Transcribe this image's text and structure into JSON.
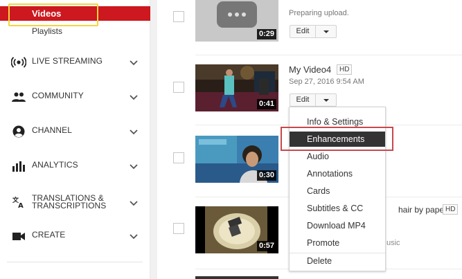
{
  "sidebar": {
    "videos_label": "Videos",
    "playlists_label": "Playlists",
    "sections": [
      {
        "label": "LIVE STREAMING",
        "icon": "live-streaming-icon"
      },
      {
        "label": "COMMUNITY",
        "icon": "community-icon"
      },
      {
        "label": "CHANNEL",
        "icon": "channel-icon"
      },
      {
        "label": "ANALYTICS",
        "icon": "analytics-icon"
      },
      {
        "label": "TRANSLATIONS &",
        "label2": "TRANSCRIPTIONS",
        "icon": "translate-icon"
      },
      {
        "label": "CREATE",
        "icon": "create-icon"
      }
    ],
    "accent_color": "#cc181e"
  },
  "videos": [
    {
      "title": "",
      "status": "Preparing upload.",
      "duration": "0:29",
      "edit_label": "Edit"
    },
    {
      "title": "My Video4",
      "hd": "HD",
      "date": "Sep 27, 2016 9:54 AM",
      "duration": "0:41",
      "edit_label": "Edit"
    },
    {
      "duration": "0:30"
    },
    {
      "title_partial": "hair by paper",
      "hd": "HD",
      "meta_partial": "usic",
      "duration": "0:57"
    }
  ],
  "dropdown": {
    "items": [
      "Info & Settings",
      "Enhancements",
      "Audio",
      "Annotations",
      "Cards",
      "Subtitles & CC",
      "Download MP4",
      "Promote",
      "Delete"
    ],
    "active_index": 1
  }
}
